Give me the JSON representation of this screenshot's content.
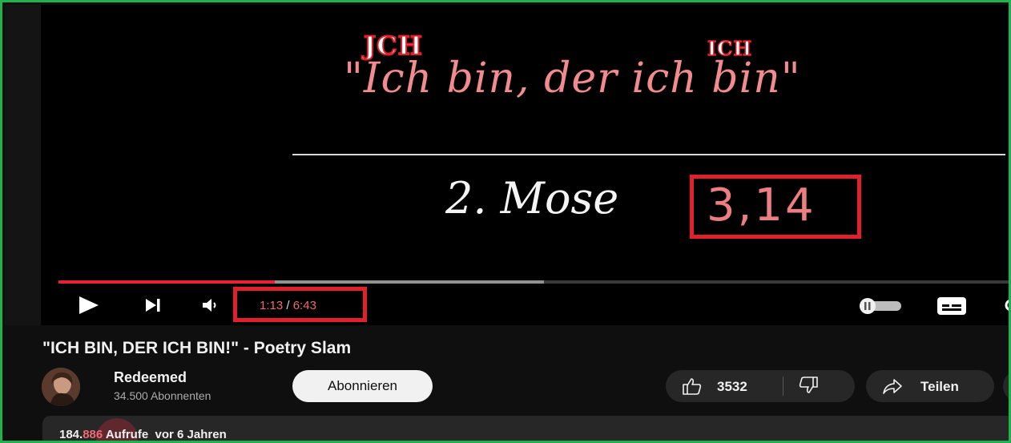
{
  "video": {
    "overlay_jch": "JCH",
    "overlay_ich": "ICH",
    "quote": "\"Ich bin, der ich bin\"",
    "reference_book": "2. Mose",
    "reference_verse": "3,14",
    "progress_played_fraction": 0.227,
    "progress_buffered_fraction": 0.51,
    "time_current": "1:13",
    "time_separator": " / ",
    "time_duration": "6:43"
  },
  "title": "\"ICH BIN, DER ICH BIN!\" - Poetry Slam",
  "channel": {
    "name": "Redeemed",
    "subscribers": "34.500 Abonnenten",
    "subscribe_label": "Abonnieren"
  },
  "actions": {
    "like_count": "3532",
    "share_label": "Teilen"
  },
  "description": {
    "views_prefix": "184.",
    "views_highlight": "886",
    "views_suffix": " Aufrufe",
    "age": "vor 6 Jahren"
  },
  "colors": {
    "highlight_red": "#e0202a",
    "frame_green": "#22b14c",
    "progress_red": "#e8232f"
  },
  "icons": [
    "play-icon",
    "next-icon",
    "volume-icon",
    "autoplay-toggle-icon",
    "captions-icon",
    "settings-icon",
    "thumbs-up-icon",
    "thumbs-down-icon",
    "share-icon"
  ]
}
